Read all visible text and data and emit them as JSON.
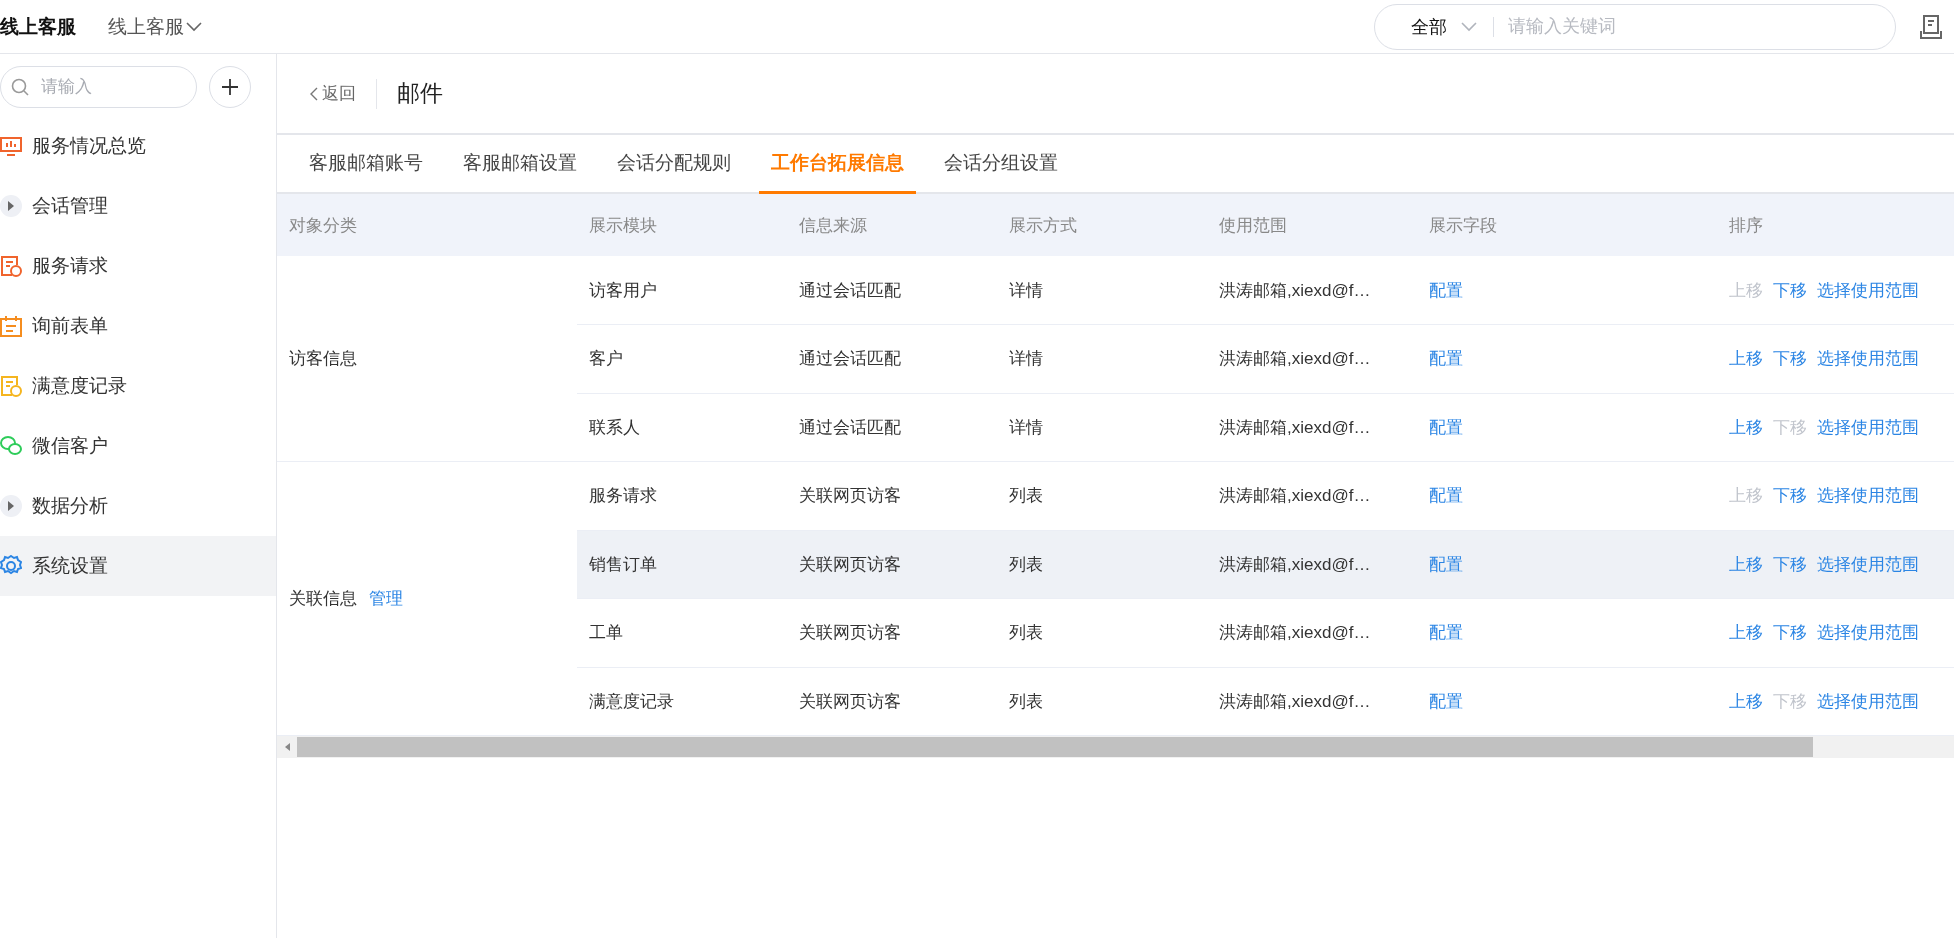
{
  "topbar": {
    "logo": "线上客服",
    "switcher": "线上客服",
    "search": {
      "scope": "全部",
      "placeholder": "请输入关键词"
    }
  },
  "sidebar": {
    "search": {
      "placeholder": "请输入"
    },
    "items": [
      {
        "label": "服务情况总览",
        "kind": "page",
        "selected": false
      },
      {
        "label": "会话管理",
        "kind": "group",
        "selected": false
      },
      {
        "label": "服务请求",
        "kind": "page",
        "selected": false
      },
      {
        "label": "询前表单",
        "kind": "page",
        "selected": false
      },
      {
        "label": "满意度记录",
        "kind": "page",
        "selected": false
      },
      {
        "label": "微信客户",
        "kind": "page",
        "selected": false
      },
      {
        "label": "数据分析",
        "kind": "group",
        "selected": false
      },
      {
        "label": "系统设置",
        "kind": "page",
        "selected": true
      }
    ]
  },
  "header": {
    "back": "返回",
    "title": "邮件"
  },
  "tabs": [
    {
      "label": "客服邮箱账号",
      "selected": false
    },
    {
      "label": "客服邮箱设置",
      "selected": false
    },
    {
      "label": "会话分配规则",
      "selected": false
    },
    {
      "label": "工作台拓展信息",
      "selected": true
    },
    {
      "label": "会话分组设置",
      "selected": false
    }
  ],
  "table": {
    "columns": [
      "对象分类",
      "展示模块",
      "信息来源",
      "展示方式",
      "使用范围",
      "展示字段",
      "排序"
    ],
    "groups": [
      {
        "label": "访客信息",
        "rows": [
          {
            "module": "访客用户",
            "source": "通过会话匹配",
            "display": "详情",
            "scope": "洪涛邮箱,xiexd@f…",
            "fields": "配置",
            "up": "上移",
            "up_disabled": true,
            "down": "下移",
            "down_disabled": false,
            "range": "选择使用范围",
            "hovered": false
          },
          {
            "module": "客户",
            "source": "通过会话匹配",
            "display": "详情",
            "scope": "洪涛邮箱,xiexd@f…",
            "fields": "配置",
            "up": "上移",
            "up_disabled": false,
            "down": "下移",
            "down_disabled": false,
            "range": "选择使用范围",
            "hovered": false
          },
          {
            "module": "联系人",
            "source": "通过会话匹配",
            "display": "详情",
            "scope": "洪涛邮箱,xiexd@f…",
            "fields": "配置",
            "up": "上移",
            "up_disabled": false,
            "down": "下移",
            "down_disabled": true,
            "range": "选择使用范围",
            "hovered": false
          }
        ]
      },
      {
        "label": "关联信息",
        "link": "管理",
        "rows": [
          {
            "module": "服务请求",
            "source": "关联网页访客",
            "display": "列表",
            "scope": "洪涛邮箱,xiexd@f…",
            "fields": "配置",
            "up": "上移",
            "up_disabled": true,
            "down": "下移",
            "down_disabled": false,
            "range": "选择使用范围",
            "hovered": false
          },
          {
            "module": "销售订单",
            "source": "关联网页访客",
            "display": "列表",
            "scope": "洪涛邮箱,xiexd@f…",
            "fields": "配置",
            "up": "上移",
            "up_disabled": false,
            "down": "下移",
            "down_disabled": false,
            "range": "选择使用范围",
            "hovered": true
          },
          {
            "module": "工单",
            "source": "关联网页访客",
            "display": "列表",
            "scope": "洪涛邮箱,xiexd@f…",
            "fields": "配置",
            "up": "上移",
            "up_disabled": false,
            "down": "下移",
            "down_disabled": false,
            "range": "选择使用范围",
            "hovered": false
          },
          {
            "module": "满意度记录",
            "source": "关联网页访客",
            "display": "列表",
            "scope": "洪涛邮箱,xiexd@f…",
            "fields": "配置",
            "up": "上移",
            "up_disabled": false,
            "down": "下移",
            "down_disabled": true,
            "range": "选择使用范围",
            "hovered": false
          }
        ]
      }
    ]
  }
}
